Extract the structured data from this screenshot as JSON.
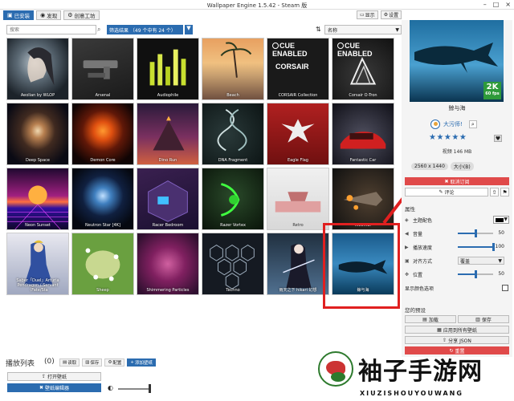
{
  "window": {
    "title": "Wallpaper Engine 1.5.42 - Steam 版"
  },
  "tabs": [
    {
      "label": "已安装",
      "icon": "monitor-icon"
    },
    {
      "label": "发现",
      "icon": "compass-icon"
    },
    {
      "label": "创意工坊",
      "icon": "gear-icon"
    }
  ],
  "top_buttons": {
    "display": "显示",
    "settings": "设置"
  },
  "search": {
    "placeholder": "搜索"
  },
  "filter": {
    "label": "筛选结果 （49 个中有 24 个）"
  },
  "sort": {
    "selected": "名称"
  },
  "tiles": [
    {
      "label": "Aeolian by WLOP"
    },
    {
      "label": "Arsenal"
    },
    {
      "label": "Audiophile"
    },
    {
      "label": "Beach"
    },
    {
      "label": "CORSAIR Collection"
    },
    {
      "label": "Corsair O-Tron"
    },
    {
      "label": "Deep Space"
    },
    {
      "label": "Demon Core"
    },
    {
      "label": "Dino Run"
    },
    {
      "label": "DNA Fragment"
    },
    {
      "label": "Eagle Flag"
    },
    {
      "label": "Fantastic Car"
    },
    {
      "label": "Neon Sunset"
    },
    {
      "label": "Neutron Star [4K]"
    },
    {
      "label": "Racer Bedroom"
    },
    {
      "label": "Razer Vortex"
    },
    {
      "label": "Retro"
    },
    {
      "label": "Ricemaf"
    },
    {
      "label": "Saber「Duel」Arturia Pendragon / Servant（Fate/Sta"
    },
    {
      "label": "Sheep"
    },
    {
      "label": "Shimmering Particles"
    },
    {
      "label": "Techno"
    },
    {
      "label": "雨天之下 hikari 幻想"
    },
    {
      "label": "鲸与海"
    }
  ],
  "cue": {
    "text": "CUE ENABLED",
    "brand": "CORSAIR"
  },
  "playlist": {
    "title": "播放列表",
    "count": "(0)",
    "load": "读取",
    "save": "保存",
    "configure": "配置",
    "add": "添加壁纸",
    "open_wallpaper": "打开壁纸",
    "editor": "壁纸编辑器"
  },
  "details": {
    "title": "鲸与海",
    "badge_res": "2K",
    "badge_fps": "60 fps",
    "author": "大污师!",
    "stars": "★★★★★",
    "info": "视频 146 MB",
    "resolution": "2560 x 1440",
    "size": "大小(B)",
    "unsubscribe": "取消订阅",
    "comment": "评论"
  },
  "properties": {
    "title": "属性",
    "scheme_color": "主题配色",
    "volume_label": "音量",
    "volume": "50",
    "volume_level": 0.5,
    "speed_label": "播放速度",
    "speed": "100",
    "speed_level": 1.0,
    "align_label": "对齐方式",
    "align_value": "覆盖",
    "position_label": "位置",
    "position": "50",
    "position_level": 0.5,
    "show_color_label": "显示颜色选项"
  },
  "presets": {
    "title": "您的预设",
    "load": "加载",
    "save": "保存",
    "apply_all": "应用到所有壁纸",
    "share": "分享 JSON",
    "reset": "重置"
  },
  "watermark": {
    "cn": "袖子手游网",
    "en": "XIUZISHOUYOUWANG"
  }
}
